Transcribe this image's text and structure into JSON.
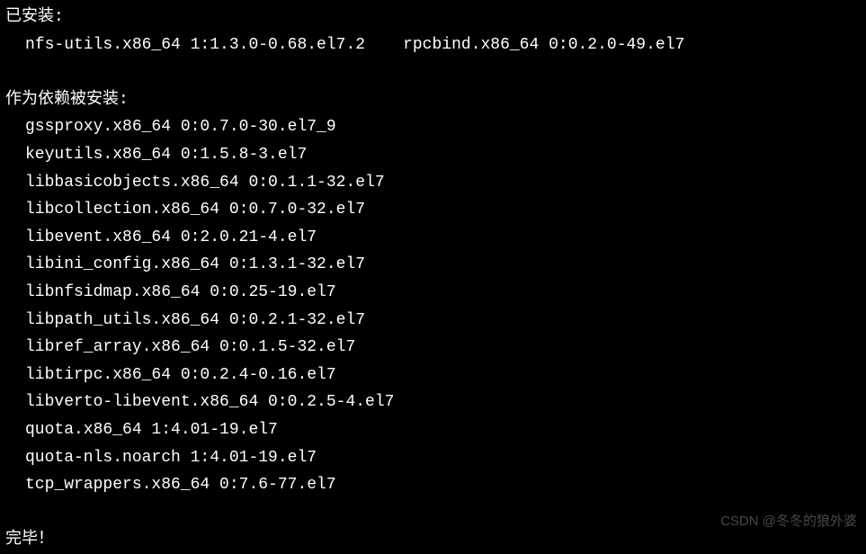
{
  "sections": {
    "installed": {
      "header": "已安装:",
      "packages": [
        "nfs-utils.x86_64 1:1.3.0-0.68.el7.2",
        "rpcbind.x86_64 0:0.2.0-49.el7"
      ]
    },
    "dependencies": {
      "header": "作为依赖被安装:",
      "packages": [
        "gssproxy.x86_64 0:0.7.0-30.el7_9",
        "keyutils.x86_64 0:1.5.8-3.el7",
        "libbasicobjects.x86_64 0:0.1.1-32.el7",
        "libcollection.x86_64 0:0.7.0-32.el7",
        "libevent.x86_64 0:2.0.21-4.el7",
        "libini_config.x86_64 0:1.3.1-32.el7",
        "libnfsidmap.x86_64 0:0.25-19.el7",
        "libpath_utils.x86_64 0:0.2.1-32.el7",
        "libref_array.x86_64 0:0.1.5-32.el7",
        "libtirpc.x86_64 0:0.2.4-0.16.el7",
        "libverto-libevent.x86_64 0:0.2.5-4.el7",
        "quota.x86_64 1:4.01-19.el7",
        "quota-nls.noarch 1:4.01-19.el7",
        "tcp_wrappers.x86_64 0:7.6-77.el7"
      ]
    },
    "complete": "完毕！"
  },
  "watermark": "CSDN @冬冬的狼外婆"
}
